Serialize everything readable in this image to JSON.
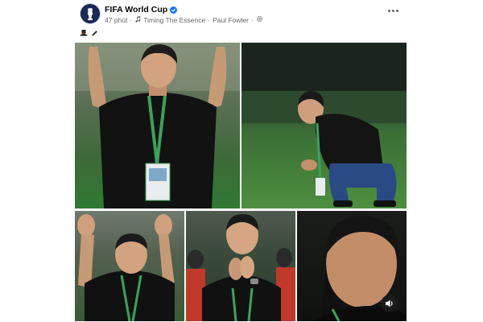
{
  "post": {
    "page_name": "FIFA World Cup",
    "time": "47 phút",
    "separator": "·",
    "music_title": "Timing The Essence",
    "music_separator": "·",
    "music_artist": "Paul Fowler",
    "settings_separator": "·"
  },
  "colors": {
    "verified": "#1877f2",
    "text_primary": "#050505",
    "text_secondary": "#65676b"
  },
  "icons": {
    "verified": "verified-badge-icon",
    "music": "music-note-icon",
    "audience": "gear-icon",
    "more": "more-options-icon",
    "caption_1": "top-hat-icon",
    "caption_2": "pencil-icon",
    "mute": "speaker-icon"
  },
  "photos": [
    {
      "name": "photo-coach-applauding"
    },
    {
      "name": "photo-coach-crouching"
    },
    {
      "name": "photo-coach-waving"
    },
    {
      "name": "photo-coach-clapping"
    },
    {
      "name": "photo-coach-closeup"
    }
  ]
}
